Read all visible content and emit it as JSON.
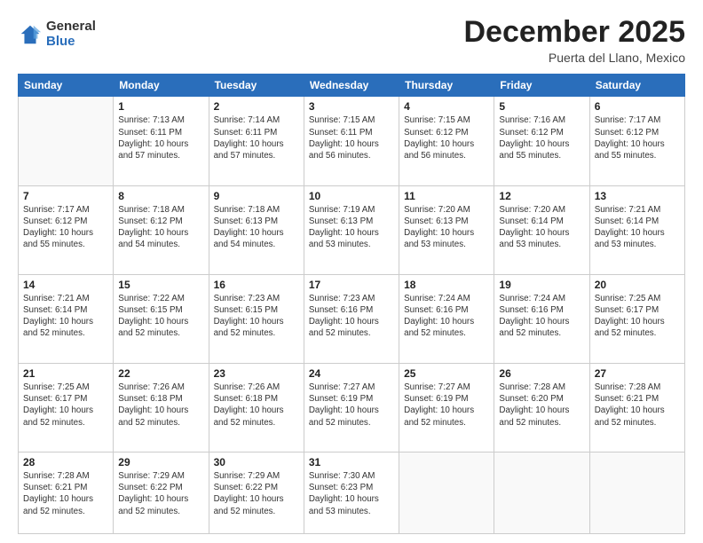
{
  "logo": {
    "general": "General",
    "blue": "Blue"
  },
  "header": {
    "month": "December 2025",
    "location": "Puerta del Llano, Mexico"
  },
  "weekdays": [
    "Sunday",
    "Monday",
    "Tuesday",
    "Wednesday",
    "Thursday",
    "Friday",
    "Saturday"
  ],
  "weeks": [
    [
      {
        "day": "",
        "info": ""
      },
      {
        "day": "1",
        "info": "Sunrise: 7:13 AM\nSunset: 6:11 PM\nDaylight: 10 hours\nand 57 minutes."
      },
      {
        "day": "2",
        "info": "Sunrise: 7:14 AM\nSunset: 6:11 PM\nDaylight: 10 hours\nand 57 minutes."
      },
      {
        "day": "3",
        "info": "Sunrise: 7:15 AM\nSunset: 6:11 PM\nDaylight: 10 hours\nand 56 minutes."
      },
      {
        "day": "4",
        "info": "Sunrise: 7:15 AM\nSunset: 6:12 PM\nDaylight: 10 hours\nand 56 minutes."
      },
      {
        "day": "5",
        "info": "Sunrise: 7:16 AM\nSunset: 6:12 PM\nDaylight: 10 hours\nand 55 minutes."
      },
      {
        "day": "6",
        "info": "Sunrise: 7:17 AM\nSunset: 6:12 PM\nDaylight: 10 hours\nand 55 minutes."
      }
    ],
    [
      {
        "day": "7",
        "info": "Sunrise: 7:17 AM\nSunset: 6:12 PM\nDaylight: 10 hours\nand 55 minutes."
      },
      {
        "day": "8",
        "info": "Sunrise: 7:18 AM\nSunset: 6:12 PM\nDaylight: 10 hours\nand 54 minutes."
      },
      {
        "day": "9",
        "info": "Sunrise: 7:18 AM\nSunset: 6:13 PM\nDaylight: 10 hours\nand 54 minutes."
      },
      {
        "day": "10",
        "info": "Sunrise: 7:19 AM\nSunset: 6:13 PM\nDaylight: 10 hours\nand 53 minutes."
      },
      {
        "day": "11",
        "info": "Sunrise: 7:20 AM\nSunset: 6:13 PM\nDaylight: 10 hours\nand 53 minutes."
      },
      {
        "day": "12",
        "info": "Sunrise: 7:20 AM\nSunset: 6:14 PM\nDaylight: 10 hours\nand 53 minutes."
      },
      {
        "day": "13",
        "info": "Sunrise: 7:21 AM\nSunset: 6:14 PM\nDaylight: 10 hours\nand 53 minutes."
      }
    ],
    [
      {
        "day": "14",
        "info": "Sunrise: 7:21 AM\nSunset: 6:14 PM\nDaylight: 10 hours\nand 52 minutes."
      },
      {
        "day": "15",
        "info": "Sunrise: 7:22 AM\nSunset: 6:15 PM\nDaylight: 10 hours\nand 52 minutes."
      },
      {
        "day": "16",
        "info": "Sunrise: 7:23 AM\nSunset: 6:15 PM\nDaylight: 10 hours\nand 52 minutes."
      },
      {
        "day": "17",
        "info": "Sunrise: 7:23 AM\nSunset: 6:16 PM\nDaylight: 10 hours\nand 52 minutes."
      },
      {
        "day": "18",
        "info": "Sunrise: 7:24 AM\nSunset: 6:16 PM\nDaylight: 10 hours\nand 52 minutes."
      },
      {
        "day": "19",
        "info": "Sunrise: 7:24 AM\nSunset: 6:16 PM\nDaylight: 10 hours\nand 52 minutes."
      },
      {
        "day": "20",
        "info": "Sunrise: 7:25 AM\nSunset: 6:17 PM\nDaylight: 10 hours\nand 52 minutes."
      }
    ],
    [
      {
        "day": "21",
        "info": "Sunrise: 7:25 AM\nSunset: 6:17 PM\nDaylight: 10 hours\nand 52 minutes."
      },
      {
        "day": "22",
        "info": "Sunrise: 7:26 AM\nSunset: 6:18 PM\nDaylight: 10 hours\nand 52 minutes."
      },
      {
        "day": "23",
        "info": "Sunrise: 7:26 AM\nSunset: 6:18 PM\nDaylight: 10 hours\nand 52 minutes."
      },
      {
        "day": "24",
        "info": "Sunrise: 7:27 AM\nSunset: 6:19 PM\nDaylight: 10 hours\nand 52 minutes."
      },
      {
        "day": "25",
        "info": "Sunrise: 7:27 AM\nSunset: 6:19 PM\nDaylight: 10 hours\nand 52 minutes."
      },
      {
        "day": "26",
        "info": "Sunrise: 7:28 AM\nSunset: 6:20 PM\nDaylight: 10 hours\nand 52 minutes."
      },
      {
        "day": "27",
        "info": "Sunrise: 7:28 AM\nSunset: 6:21 PM\nDaylight: 10 hours\nand 52 minutes."
      }
    ],
    [
      {
        "day": "28",
        "info": "Sunrise: 7:28 AM\nSunset: 6:21 PM\nDaylight: 10 hours\nand 52 minutes."
      },
      {
        "day": "29",
        "info": "Sunrise: 7:29 AM\nSunset: 6:22 PM\nDaylight: 10 hours\nand 52 minutes."
      },
      {
        "day": "30",
        "info": "Sunrise: 7:29 AM\nSunset: 6:22 PM\nDaylight: 10 hours\nand 52 minutes."
      },
      {
        "day": "31",
        "info": "Sunrise: 7:30 AM\nSunset: 6:23 PM\nDaylight: 10 hours\nand 53 minutes."
      },
      {
        "day": "",
        "info": ""
      },
      {
        "day": "",
        "info": ""
      },
      {
        "day": "",
        "info": ""
      }
    ]
  ]
}
